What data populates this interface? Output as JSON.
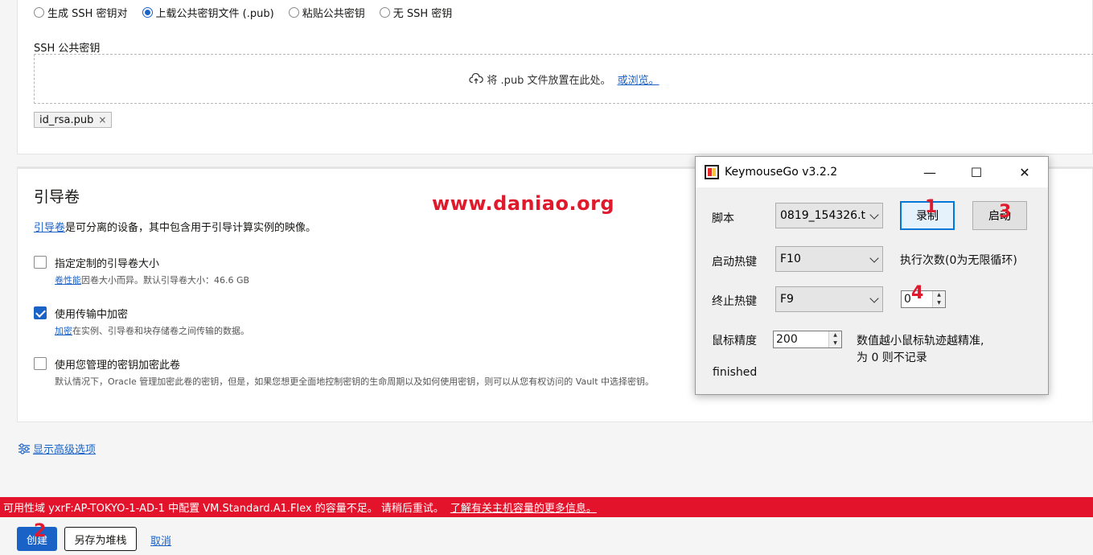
{
  "ssh": {
    "radio_options": [
      "生成 SSH 密钥对",
      "上载公共密钥文件 (.pub)",
      "粘贴公共密钥",
      "无 SSH 密钥"
    ],
    "field_label": "SSH 公共密钥",
    "drop_text": "将 .pub 文件放置在此处。",
    "drop_browse": "或浏览。",
    "file_chip": "id_rsa.pub",
    "file_chip_remove": "×"
  },
  "boot": {
    "title": "引导卷",
    "desc_link": "引导卷",
    "desc_text": "是可分离的设备，其中包含用于引导计算实例的映像。",
    "opt1_label": "指定定制的引导卷大小",
    "opt1_sub_link": "卷性能",
    "opt1_sub_text": "因卷大小而异。默认引导卷大小：46.6 GB",
    "opt2_label": "使用传输中加密",
    "opt2_sub_link": "加密",
    "opt2_sub_text": "在实例、引导卷和块存储卷之间传输的数据。",
    "opt3_label": "使用您管理的密钥加密此卷",
    "opt3_sub_text": "默认情况下，Oracle 管理加密此卷的密钥，但是，如果您想更全面地控制密钥的生命周期以及如何使用密钥，则可以从您有权访问的 Vault 中选择密钥。"
  },
  "watermark": "www.daniao.org",
  "advanced_link": "显示高级选项",
  "error": {
    "message": "可用性域 yxrF:AP-TOKYO-1-AD-1 中配置 VM.Standard.A1.Flex 的容量不足。 请稍后重试。",
    "link": "了解有关主机容量的更多信息。"
  },
  "footer": {
    "create": "创建",
    "save_stack": "另存为堆栈",
    "cancel": "取消"
  },
  "annotations": [
    "1",
    "2",
    "3",
    "4"
  ],
  "keymouse": {
    "title": "KeymouseGo v3.2.2",
    "minimize": "—",
    "maximize": "☐",
    "close": "✕",
    "script_label": "脚本",
    "script_value": "0819_154326.t",
    "record_btn": "录制",
    "start_btn": "启动",
    "start_hotkey_label": "启动热键",
    "start_hotkey_value": "F10",
    "exec_count_label": "执行次数(0为无限循环)",
    "stop_hotkey_label": "终止热键",
    "stop_hotkey_value": "F9",
    "exec_count_value": "0",
    "mouse_precision_label": "鼠标精度",
    "mouse_precision_value": "200",
    "precision_hint_1": "数值越小鼠标轨迹越精准,",
    "precision_hint_2": "为 0 则不记录",
    "status": "finished"
  }
}
